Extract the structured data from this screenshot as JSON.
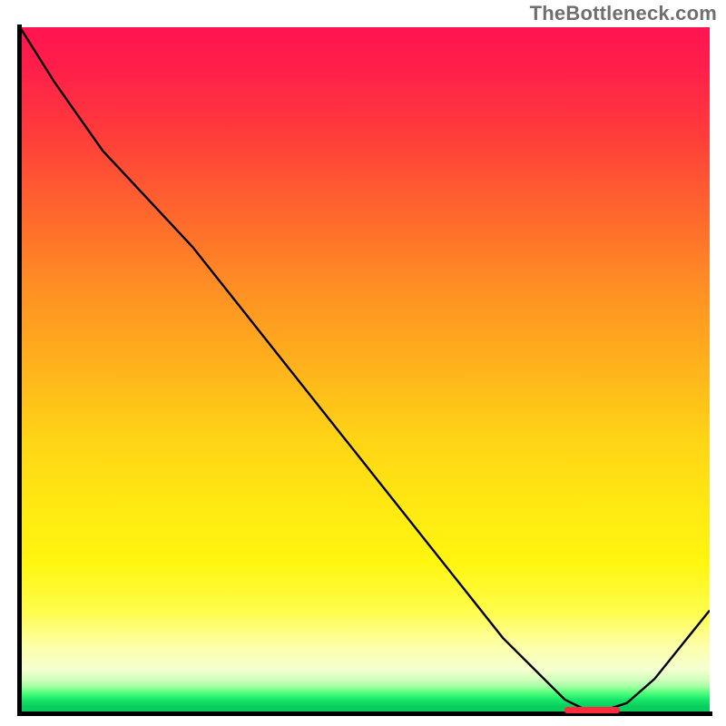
{
  "watermark": "TheBottleneck.com",
  "chart_data": {
    "type": "line",
    "title": "",
    "xlabel": "",
    "ylabel": "",
    "xlim": [
      0,
      100
    ],
    "ylim": [
      0,
      100
    ],
    "series": [
      {
        "name": "bottleneck-curve",
        "x": [
          0,
          5,
          12,
          25,
          40,
          55,
          70,
          79,
          82,
          85,
          88,
          92,
          100
        ],
        "values": [
          100,
          92,
          82,
          68,
          49,
          30,
          11,
          2,
          0.5,
          0.5,
          1.5,
          5,
          15
        ]
      }
    ],
    "marker": {
      "name": "optimal-range",
      "x_start": 79,
      "x_end": 87,
      "y": 0.5
    },
    "background_gradient": {
      "top_color": "#ff1450",
      "mid_color": "#ffe912",
      "bottom_color": "#09ce5d"
    }
  }
}
